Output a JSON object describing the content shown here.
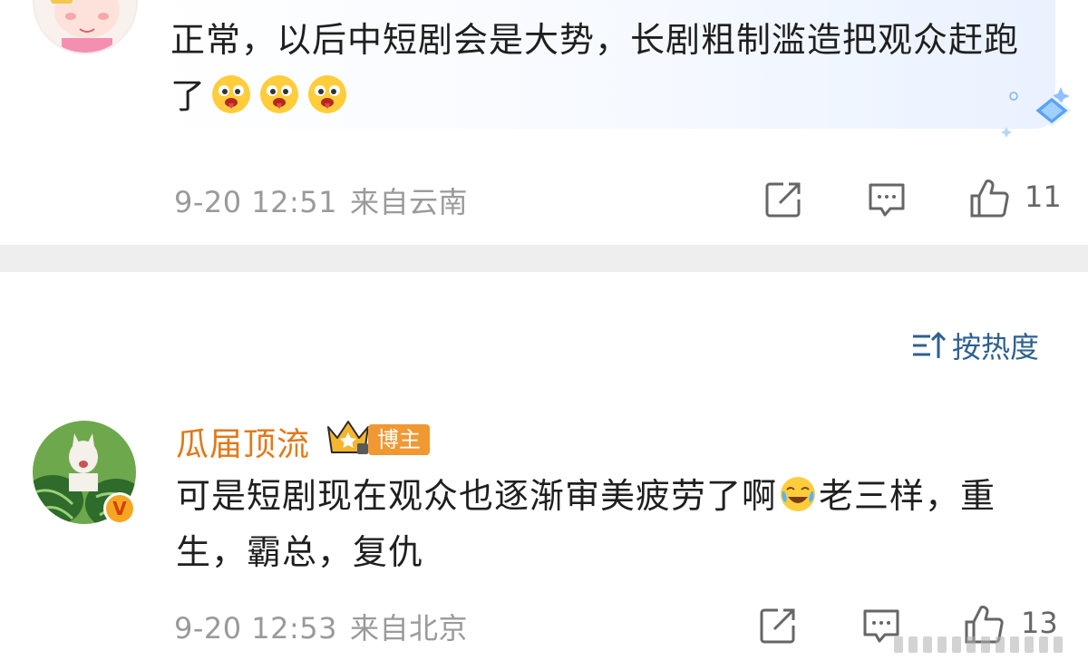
{
  "comments": [
    {
      "text": "正常，以后中短剧会是大势，长剧粗制滥造把观众赶跑了",
      "emojis": [
        "tongue-face-emoji",
        "tongue-face-emoji",
        "tongue-face-emoji"
      ],
      "time": "9-20 12:51",
      "location": "来自云南",
      "likes": "11"
    },
    {
      "username": "瓜届顶流",
      "role_tag": "博主",
      "text_before": "可是短剧现在观众也逐渐审美疲劳了啊",
      "emoji": "crying-laughing-emoji",
      "text_after": "老三样，重生，霸总，复仇",
      "time": "9-20 12:53",
      "location": "来自北京",
      "likes": "13"
    }
  ],
  "sort": {
    "label": "按热度",
    "icon": "sort-icon"
  },
  "colors": {
    "username": "#e0791a",
    "sort": "#2f5f92",
    "meta": "#9a9a9a",
    "role_tag": "#f09832",
    "divider": "#eeeeee"
  }
}
